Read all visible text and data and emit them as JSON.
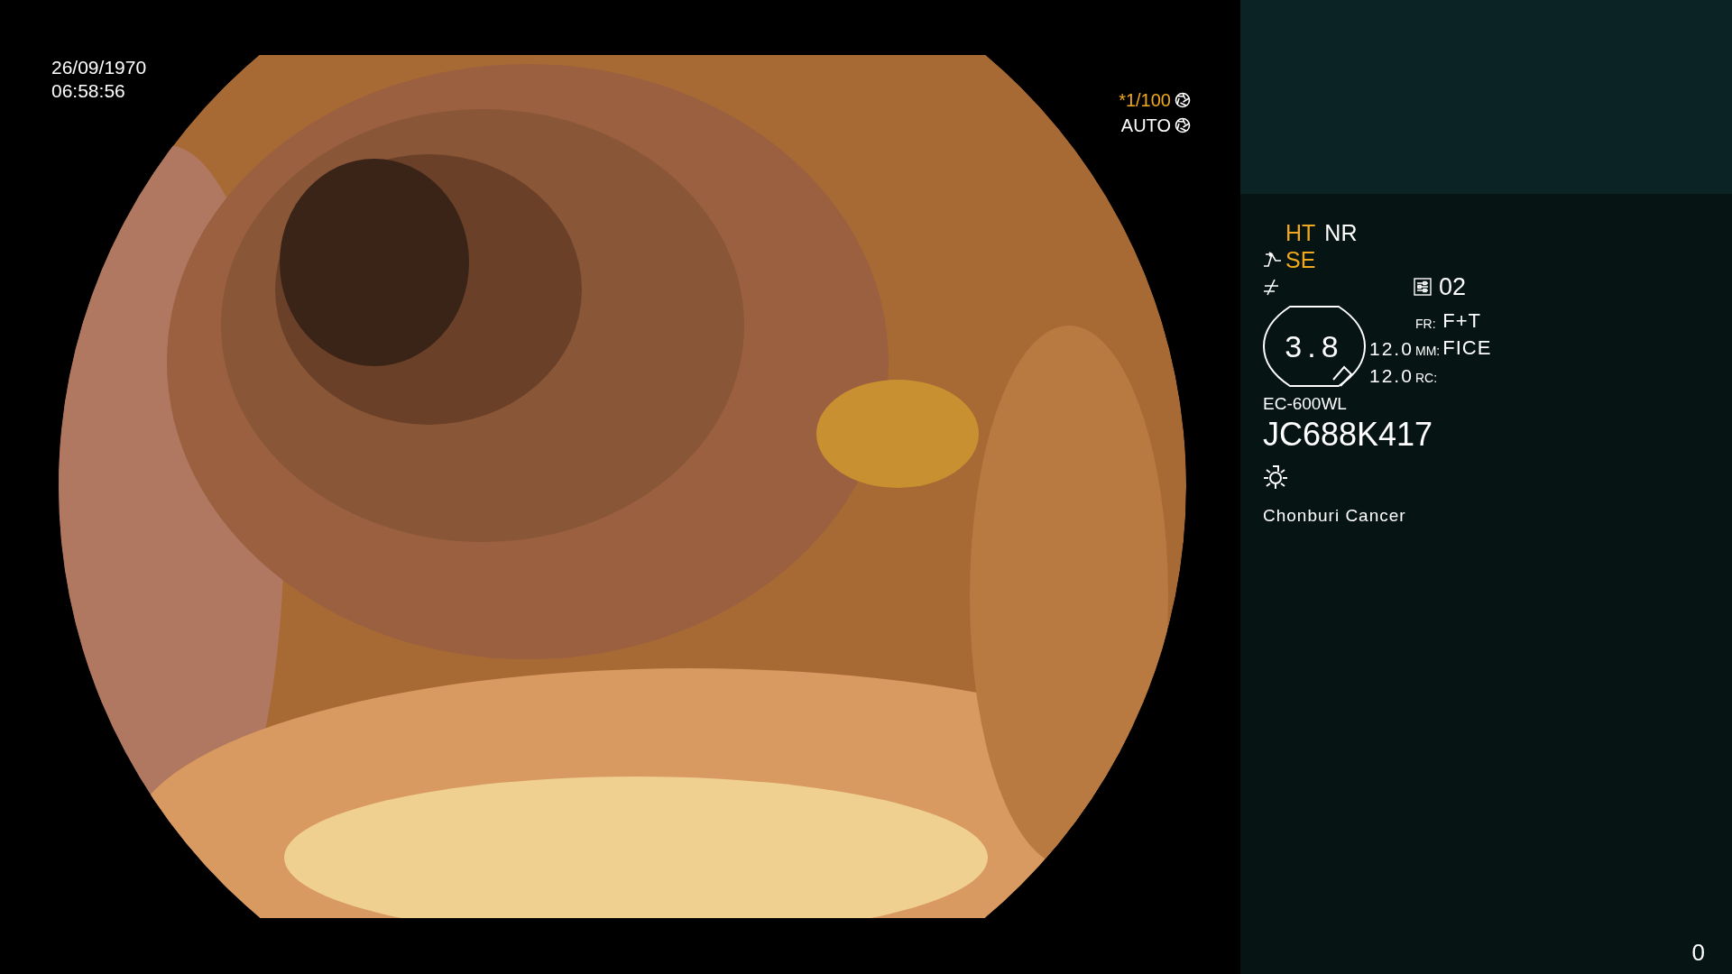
{
  "view": {
    "date": "26/09/1970",
    "time": "06:58:56",
    "shutter": "*1/100",
    "iris": "AUTO"
  },
  "panel": {
    "modes": [
      {
        "label": "HT",
        "active": true
      },
      {
        "label": "NR",
        "active": false
      }
    ],
    "enhance": {
      "label": "SE",
      "active": true
    },
    "preset": "02",
    "zoom": "3.8",
    "scale_values": [
      "12.0",
      "12.0"
    ],
    "settings": [
      {
        "key": "FR:",
        "value": "F+T"
      },
      {
        "key": "MM:",
        "value": "FICE"
      },
      {
        "key": "RC:"
      }
    ],
    "scope_model": "EC-600WL",
    "serial": "JC688K417",
    "site": "Chonburi Cancer",
    "counter": "0"
  }
}
